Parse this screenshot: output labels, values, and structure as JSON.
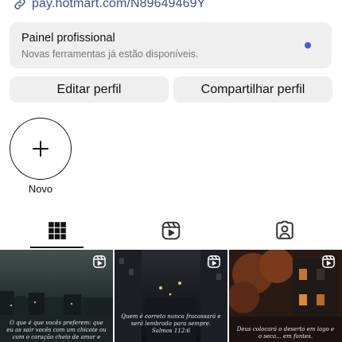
{
  "profile": {
    "link": "pay.hotmart.com/N89649469Y"
  },
  "professional_panel": {
    "title": "Painel profissional",
    "subtitle": "Novas ferramentas já estão disponíveis."
  },
  "actions": {
    "edit_label": "Editar perfil",
    "share_label": "Compartilhar perfil"
  },
  "highlights": {
    "new_label": "Novo"
  },
  "tabs": {
    "selected": "grid"
  },
  "posts": [
    {
      "caption": "O que é que vocês preferem: que eu as sair vocês com um chicote ou com o coração cheio de amor e bondade?"
    },
    {
      "caption": "Quem é correto nunca fracassará e será lembrado para sempre. Salmos 112:6"
    },
    {
      "caption": "Deus colocará o deserto em lago e o seca... em fontes."
    }
  ]
}
